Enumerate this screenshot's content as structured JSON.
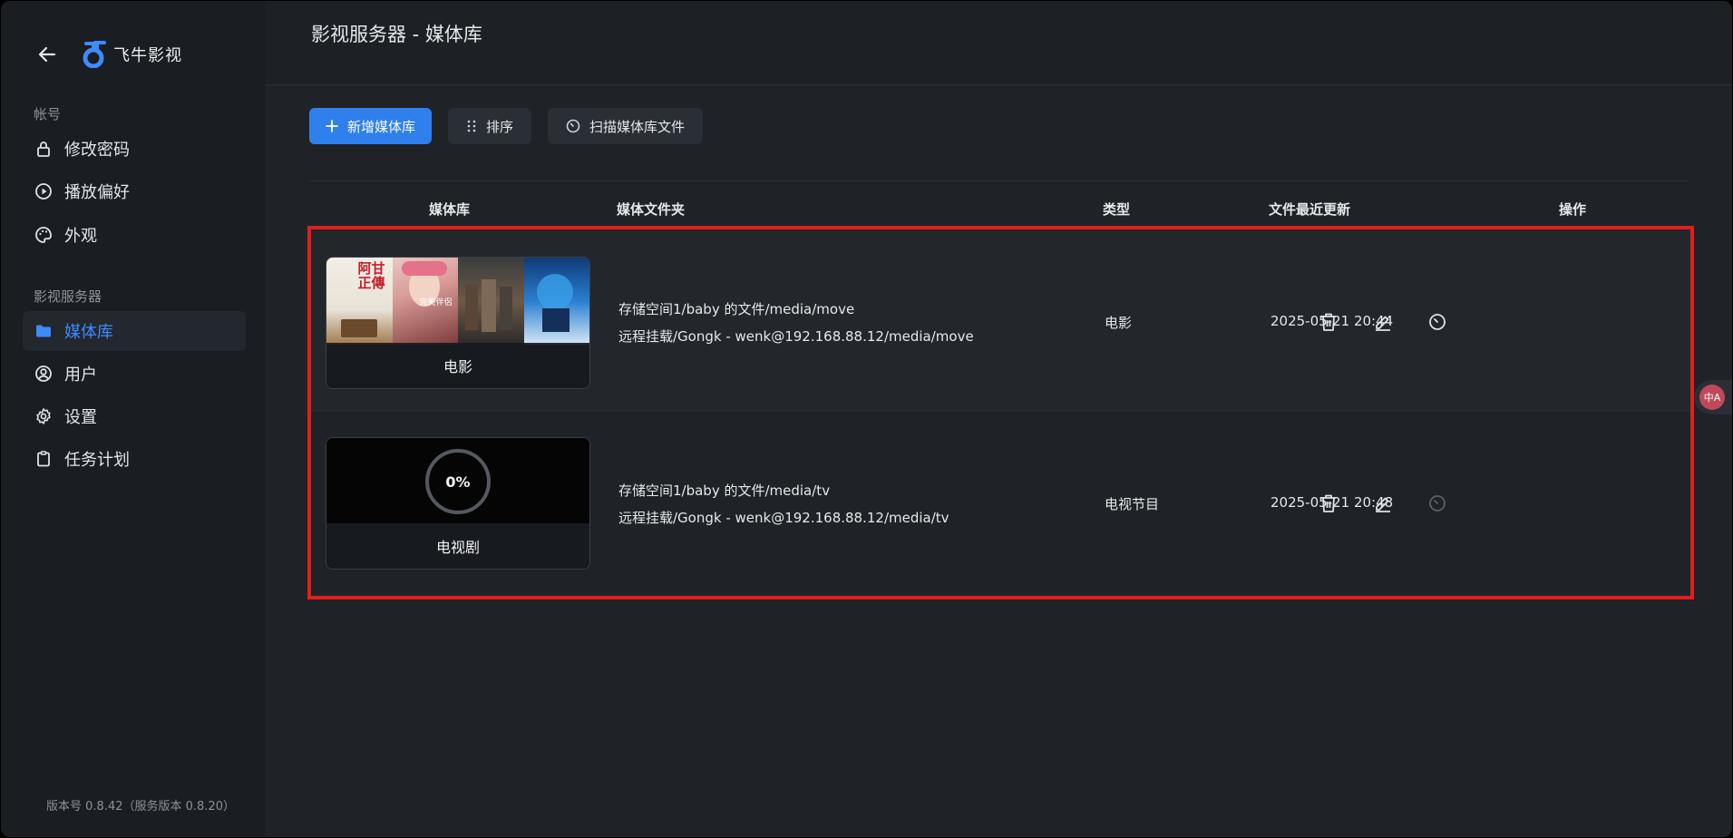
{
  "brand": {
    "name": "飞牛影视",
    "logo_color": "#3d8bfd"
  },
  "sidebar": {
    "sections": [
      {
        "title": "帐号",
        "items": [
          {
            "label": "修改密码",
            "icon": "lock-icon"
          },
          {
            "label": "播放偏好",
            "icon": "play-circle-icon"
          },
          {
            "label": "外观",
            "icon": "palette-icon"
          }
        ]
      },
      {
        "title": "影视服务器",
        "items": [
          {
            "label": "媒体库",
            "icon": "folder-icon",
            "active": true
          },
          {
            "label": "用户",
            "icon": "user-circle-icon"
          },
          {
            "label": "设置",
            "icon": "gear-icon"
          },
          {
            "label": "任务计划",
            "icon": "clipboard-icon"
          }
        ]
      }
    ],
    "version": "版本号 0.8.42（服务版本 0.8.20）"
  },
  "header": {
    "title": "影视服务器 - 媒体库"
  },
  "toolbar": {
    "add_label": "新增媒体库",
    "sort_label": "排序",
    "scan_label": "扫描媒体库文件"
  },
  "table": {
    "columns": [
      "媒体库",
      "媒体文件夹",
      "类型",
      "文件最近更新",
      "操作"
    ],
    "rows": [
      {
        "name": "电影",
        "folders": [
          "存储空间1/baby 的文件/media/move",
          "远程挂载/Gongk - wenk@192.168.88.12/media/move"
        ],
        "type": "电影",
        "updated": "2025-05-21 20:44",
        "poster_text": [
          "阿甘正傳",
          "完美伴侶"
        ]
      },
      {
        "name": "电视剧",
        "progress": "0%",
        "folders": [
          "存储空间1/baby 的文件/media/tv",
          "远程挂载/Gongk - wenk@192.168.88.12/media/tv"
        ],
        "type": "电视节目",
        "updated": "2025-05-21 20:48"
      }
    ]
  },
  "translate_badge": "中A",
  "colors": {
    "accent": "#2f80ed",
    "highlight_border": "#e11d1d",
    "active_nav": "#3d8bfd"
  }
}
